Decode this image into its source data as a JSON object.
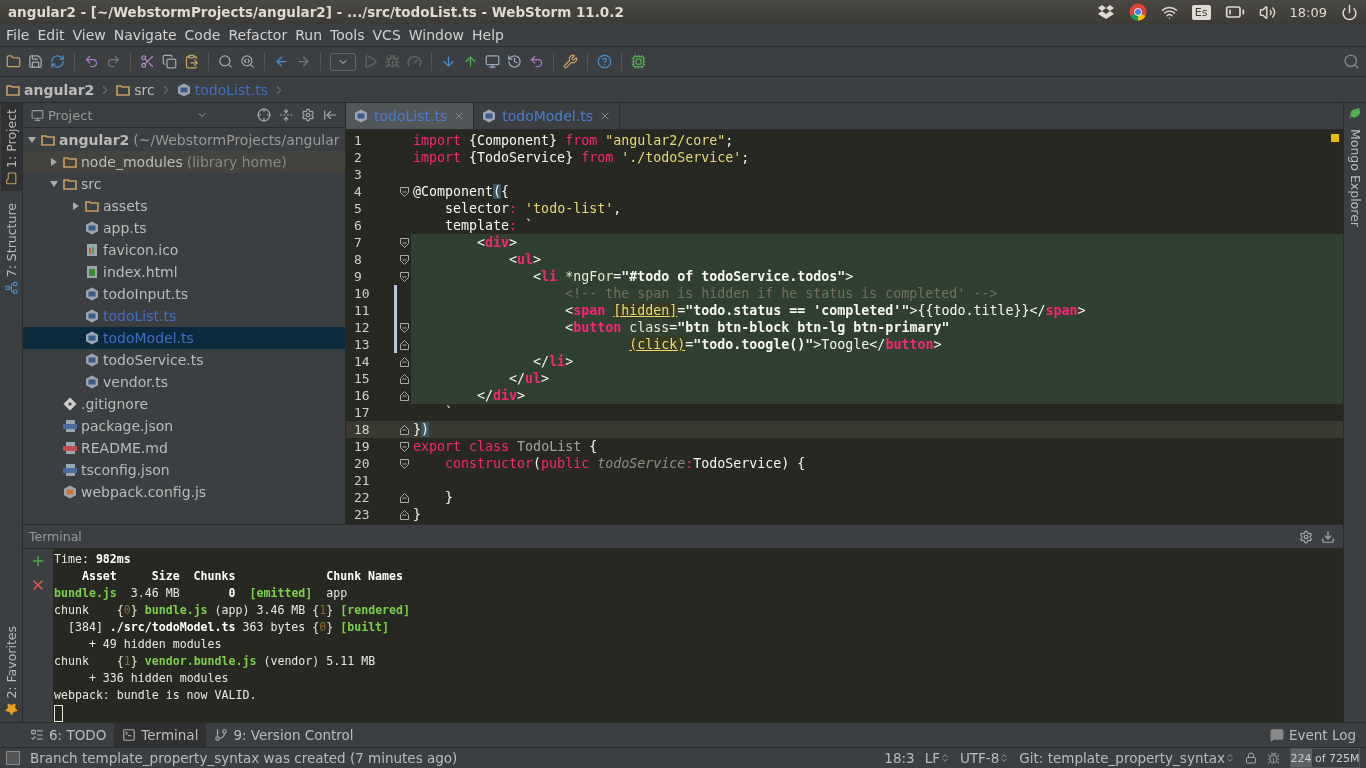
{
  "top_panel": {
    "title": "angular2 - [~/WebstormProjects/angular2] - .../src/todoList.ts - WebStorm 11.0.2",
    "keyboard": "Es",
    "time": "18:09"
  },
  "menu": [
    "File",
    "Edit",
    "View",
    "Navigate",
    "Code",
    "Refactor",
    "Run",
    "Tools",
    "VCS",
    "Window",
    "Help"
  ],
  "breadcrumb": [
    {
      "label": "angular2",
      "kind": "folder",
      "modified": false
    },
    {
      "label": "src",
      "kind": "folder",
      "modified": false
    },
    {
      "label": "todoList.ts",
      "kind": "ts",
      "modified": true
    }
  ],
  "left_stripe": [
    {
      "label": "1: Project",
      "kind": "project",
      "selected": true
    },
    {
      "label": "7: Structure",
      "kind": "structure",
      "selected": false
    }
  ],
  "favorites": {
    "label": "2: Favorites"
  },
  "right_stripe": {
    "label": "Mongo Explorer"
  },
  "project": {
    "title": "Project",
    "tree": [
      {
        "label": "angular2",
        "note": "(~/WebstormProjects/angular",
        "kind": "folder",
        "expanded": true,
        "selected": false,
        "modified": false,
        "children": [
          {
            "label": "node_modules",
            "note": "(library home)",
            "kind": "library",
            "expanded": false,
            "selected": false,
            "modified": false
          },
          {
            "label": "src",
            "kind": "folder",
            "expanded": true,
            "selected": false,
            "modified": false,
            "children": [
              {
                "label": "assets",
                "kind": "folder",
                "expanded": false,
                "selected": false,
                "modified": false
              },
              {
                "label": "app.ts",
                "kind": "ts",
                "selected": false,
                "modified": false
              },
              {
                "label": "favicon.ico",
                "kind": "image",
                "selected": false,
                "modified": false
              },
              {
                "label": "index.html",
                "kind": "html",
                "selected": false,
                "modified": false
              },
              {
                "label": "todoInput.ts",
                "kind": "ts",
                "selected": false,
                "modified": false
              },
              {
                "label": "todoList.ts",
                "kind": "ts",
                "selected": false,
                "modified": true
              },
              {
                "label": "todoModel.ts",
                "kind": "ts",
                "selected": true,
                "modified": true
              },
              {
                "label": "todoService.ts",
                "kind": "ts",
                "selected": false,
                "modified": false
              },
              {
                "label": "vendor.ts",
                "kind": "ts",
                "selected": false,
                "modified": false
              }
            ]
          },
          {
            "label": ".gitignore",
            "kind": "git",
            "selected": false,
            "modified": false
          },
          {
            "label": "package.json",
            "kind": "json",
            "selected": false,
            "modified": false
          },
          {
            "label": "README.md",
            "kind": "md",
            "selected": false,
            "modified": false
          },
          {
            "label": "tsconfig.json",
            "kind": "json",
            "selected": false,
            "modified": false
          },
          {
            "label": "webpack.config.js",
            "kind": "js",
            "selected": false,
            "modified": false
          }
        ]
      }
    ]
  },
  "editor": {
    "tabs": [
      {
        "label": "todoList.ts",
        "selected": true,
        "modified": true
      },
      {
        "label": "todoModel.ts",
        "selected": false,
        "modified": true
      }
    ],
    "lines": [
      {
        "number": "1",
        "injected": false,
        "current": false,
        "changed": false,
        "tokens": [
          {
            "text": "import",
            "kind": "kw"
          },
          {
            "text": " {Component} ",
            "kind": "plain"
          },
          {
            "text": "from",
            "kind": "kw"
          },
          {
            "text": " \"angular2/core\"",
            "kind": "str"
          },
          {
            "text": ";",
            "kind": "plain"
          }
        ]
      },
      {
        "number": "2",
        "injected": false,
        "current": false,
        "changed": false,
        "tokens": [
          {
            "text": "import",
            "kind": "kw"
          },
          {
            "text": " {TodoService} ",
            "kind": "plain"
          },
          {
            "text": "from",
            "kind": "kw"
          },
          {
            "text": " './todoService'",
            "kind": "str"
          },
          {
            "text": ";",
            "kind": "plain"
          }
        ]
      },
      {
        "number": "3",
        "injected": false,
        "current": false,
        "changed": false
      },
      {
        "number": "4",
        "injected": false,
        "current": false,
        "changed": false,
        "fold": {
          "kind": "start"
        },
        "tokens": [
          {
            "text": "@Component",
            "kind": "plain"
          },
          {
            "text": "(",
            "kind": "paren"
          },
          {
            "text": "{",
            "kind": "plain"
          }
        ]
      },
      {
        "number": "5",
        "injected": false,
        "current": false,
        "changed": false,
        "tokens": [
          {
            "text": "    selector",
            "kind": "plain"
          },
          {
            "text": ":",
            "kind": "kw"
          },
          {
            "text": " 'todo-list'",
            "kind": "str"
          },
          {
            "text": ",",
            "kind": "plain"
          }
        ]
      },
      {
        "number": "6",
        "injected": false,
        "current": false,
        "changed": false,
        "tokens": [
          {
            "text": "    template",
            "kind": "plain"
          },
          {
            "text": ":",
            "kind": "kw"
          },
          {
            "text": " `",
            "kind": "plain"
          }
        ]
      },
      {
        "number": "7",
        "injected": true,
        "current": false,
        "changed": false,
        "fold": {
          "kind": "start"
        },
        "tokens": [
          {
            "text": "        <",
            "kind": "plain"
          },
          {
            "text": "div",
            "kind": "tag"
          },
          {
            "text": ">",
            "kind": "plain"
          }
        ]
      },
      {
        "number": "8",
        "injected": true,
        "current": false,
        "changed": false,
        "fold": {
          "kind": "start"
        },
        "tokens": [
          {
            "text": "            <",
            "kind": "plain"
          },
          {
            "text": "ul",
            "kind": "tag"
          },
          {
            "text": ">",
            "kind": "plain"
          }
        ]
      },
      {
        "number": "9",
        "injected": true,
        "current": false,
        "changed": false,
        "fold": {
          "kind": "start"
        },
        "tokens": [
          {
            "text": "               <",
            "kind": "plain"
          },
          {
            "text": "li",
            "kind": "tag"
          },
          {
            "text": " *ngFor",
            "kind": "attr"
          },
          {
            "text": "=",
            "kind": "plain"
          },
          {
            "text": "\"#todo of todoService.todos\"",
            "kind": "val"
          },
          {
            "text": ">",
            "kind": "plain"
          }
        ]
      },
      {
        "number": "10",
        "injected": true,
        "current": false,
        "changed": true,
        "tokens": [
          {
            "text": "                   <!-- the span is hidden if he status is completed' -->",
            "kind": "comment"
          }
        ]
      },
      {
        "number": "11",
        "injected": true,
        "current": false,
        "changed": true,
        "tokens": [
          {
            "text": "                   <",
            "kind": "plain"
          },
          {
            "text": "span",
            "kind": "tag"
          },
          {
            "text": " [hidden]",
            "kind": "bind"
          },
          {
            "text": "=",
            "kind": "plain"
          },
          {
            "text": "\"todo.status == 'completed'\"",
            "kind": "val"
          },
          {
            "text": ">{{todo.title}}</",
            "kind": "plain"
          },
          {
            "text": "span",
            "kind": "tag"
          },
          {
            "text": ">",
            "kind": "plain"
          }
        ]
      },
      {
        "number": "12",
        "injected": true,
        "current": false,
        "changed": true,
        "fold": {
          "kind": "start"
        },
        "tokens": [
          {
            "text": "                   <",
            "kind": "plain"
          },
          {
            "text": "button",
            "kind": "tag"
          },
          {
            "text": " class",
            "kind": "attr"
          },
          {
            "text": "=",
            "kind": "plain"
          },
          {
            "text": "\"btn btn-block btn-lg btn-primary\"",
            "kind": "val"
          }
        ]
      },
      {
        "number": "13",
        "injected": true,
        "current": false,
        "changed": true,
        "fold": {
          "kind": "end"
        },
        "tokens": [
          {
            "text": "                           (click)",
            "kind": "bind"
          },
          {
            "text": "=",
            "kind": "plain"
          },
          {
            "text": "\"todo.toogle()\"",
            "kind": "val"
          },
          {
            "text": ">Toogle</",
            "kind": "plain"
          },
          {
            "text": "button",
            "kind": "tag"
          },
          {
            "text": ">",
            "kind": "plain"
          }
        ]
      },
      {
        "number": "14",
        "injected": true,
        "current": false,
        "changed": false,
        "fold": {
          "kind": "end"
        },
        "tokens": [
          {
            "text": "               </",
            "kind": "plain"
          },
          {
            "text": "li",
            "kind": "tag"
          },
          {
            "text": ">",
            "kind": "plain"
          }
        ]
      },
      {
        "number": "15",
        "injected": true,
        "current": false,
        "changed": false,
        "fold": {
          "kind": "end"
        },
        "tokens": [
          {
            "text": "            </",
            "kind": "plain"
          },
          {
            "text": "ul",
            "kind": "tag"
          },
          {
            "text": ">",
            "kind": "plain"
          }
        ]
      },
      {
        "number": "16",
        "injected": true,
        "current": false,
        "changed": false,
        "fold": {
          "kind": "end"
        },
        "tokens": [
          {
            "text": "        </",
            "kind": "plain"
          },
          {
            "text": "div",
            "kind": "tag"
          },
          {
            "text": ">",
            "kind": "plain"
          }
        ]
      },
      {
        "number": "17",
        "injected": false,
        "current": false,
        "changed": false,
        "tokens": [
          {
            "text": "    `",
            "kind": "plain"
          }
        ]
      },
      {
        "number": "18",
        "injected": false,
        "current": true,
        "changed": false,
        "fold": {
          "kind": "end"
        },
        "tokens": [
          {
            "text": "}",
            "kind": "plain"
          },
          {
            "text": ")",
            "kind": "paren"
          }
        ]
      },
      {
        "number": "19",
        "injected": false,
        "current": false,
        "changed": false,
        "fold": {
          "kind": "start"
        },
        "tokens": [
          {
            "text": "export",
            "kind": "kw"
          },
          {
            "text": " class",
            "kind": "kw"
          },
          {
            "text": " TodoList",
            "kind": "cls"
          },
          {
            "text": " {",
            "kind": "plain"
          }
        ]
      },
      {
        "number": "20",
        "injected": false,
        "current": false,
        "changed": false,
        "fold": {
          "kind": "start"
        },
        "tokens": [
          {
            "text": "    constructor",
            "kind": "kw"
          },
          {
            "text": "(",
            "kind": "plain"
          },
          {
            "text": "public",
            "kind": "kw"
          },
          {
            "text": " todoService",
            "kind": "param"
          },
          {
            "text": ":",
            "kind": "kw"
          },
          {
            "text": "TodoService) {",
            "kind": "plain"
          }
        ]
      },
      {
        "number": "21",
        "injected": false,
        "current": false,
        "changed": false
      },
      {
        "number": "22",
        "injected": false,
        "current": false,
        "changed": false,
        "fold": {
          "kind": "end"
        },
        "tokens": [
          {
            "text": "    }",
            "kind": "plain"
          }
        ]
      },
      {
        "number": "23",
        "injected": false,
        "current": false,
        "changed": false,
        "fold": {
          "kind": "end"
        },
        "tokens": [
          {
            "text": "}",
            "kind": "plain"
          }
        ]
      }
    ]
  },
  "terminal": {
    "title": "Terminal",
    "lines": [
      [
        {
          "text": "Time:",
          "kind": "plain"
        },
        {
          "text": " 982ms",
          "kind": "bold"
        }
      ],
      [
        {
          "text": "    Asset     Size  Chunks             Chunk Names",
          "kind": "bold"
        }
      ],
      [
        {
          "text": "bundle.js",
          "kind": "green"
        },
        {
          "text": "  3.46 MB",
          "kind": "plain"
        },
        {
          "text": "       0",
          "kind": "bold"
        },
        {
          "text": "  [emitted]",
          "kind": "green"
        },
        {
          "text": "  app",
          "kind": "plain"
        }
      ],
      [
        {
          "text": "chunk    {",
          "kind": "plain"
        },
        {
          "text": "0",
          "kind": "num"
        },
        {
          "text": "}",
          "kind": "plain"
        },
        {
          "text": " bundle.js",
          "kind": "green"
        },
        {
          "text": " (app) 3.46 MB {",
          "kind": "plain"
        },
        {
          "text": "1",
          "kind": "num"
        },
        {
          "text": "}",
          "kind": "plain"
        },
        {
          "text": " [rendered]",
          "kind": "green"
        }
      ],
      [
        {
          "text": "  [384]",
          "kind": "plain"
        },
        {
          "text": " ./src/todoModel.ts",
          "kind": "bold"
        },
        {
          "text": " 363 bytes {",
          "kind": "plain"
        },
        {
          "text": "0",
          "kind": "num"
        },
        {
          "text": "}",
          "kind": "plain"
        },
        {
          "text": " [built]",
          "kind": "green"
        }
      ],
      [
        {
          "text": "     + 49 hidden modules",
          "kind": "plain"
        }
      ],
      [
        {
          "text": "chunk    {",
          "kind": "plain"
        },
        {
          "text": "1",
          "kind": "num"
        },
        {
          "text": "}",
          "kind": "plain"
        },
        {
          "text": " vendor.bundle.js",
          "kind": "green"
        },
        {
          "text": " (vendor) 5.11 MB",
          "kind": "plain"
        }
      ],
      [
        {
          "text": "     + 336 hidden modules",
          "kind": "plain"
        }
      ],
      [
        {
          "text": "webpack: bundle is now VALID.",
          "kind": "plain"
        }
      ]
    ]
  },
  "tool_tabs": [
    {
      "label": "6: TODO",
      "kind": "todo",
      "selected": false
    },
    {
      "label": "Terminal",
      "kind": "terminal",
      "selected": true
    },
    {
      "label": "9: Version Control",
      "kind": "vcs",
      "selected": false
    }
  ],
  "event_log": "Event Log",
  "status": {
    "message": "Branch template_property_syntax was created (7 minutes ago)",
    "position": "18:3",
    "line_ending": "LF",
    "encoding": "UTF-8",
    "branch": "Git: template_property_syntax",
    "memory": {
      "text": "224 of 725M",
      "level": 0.31
    }
  }
}
